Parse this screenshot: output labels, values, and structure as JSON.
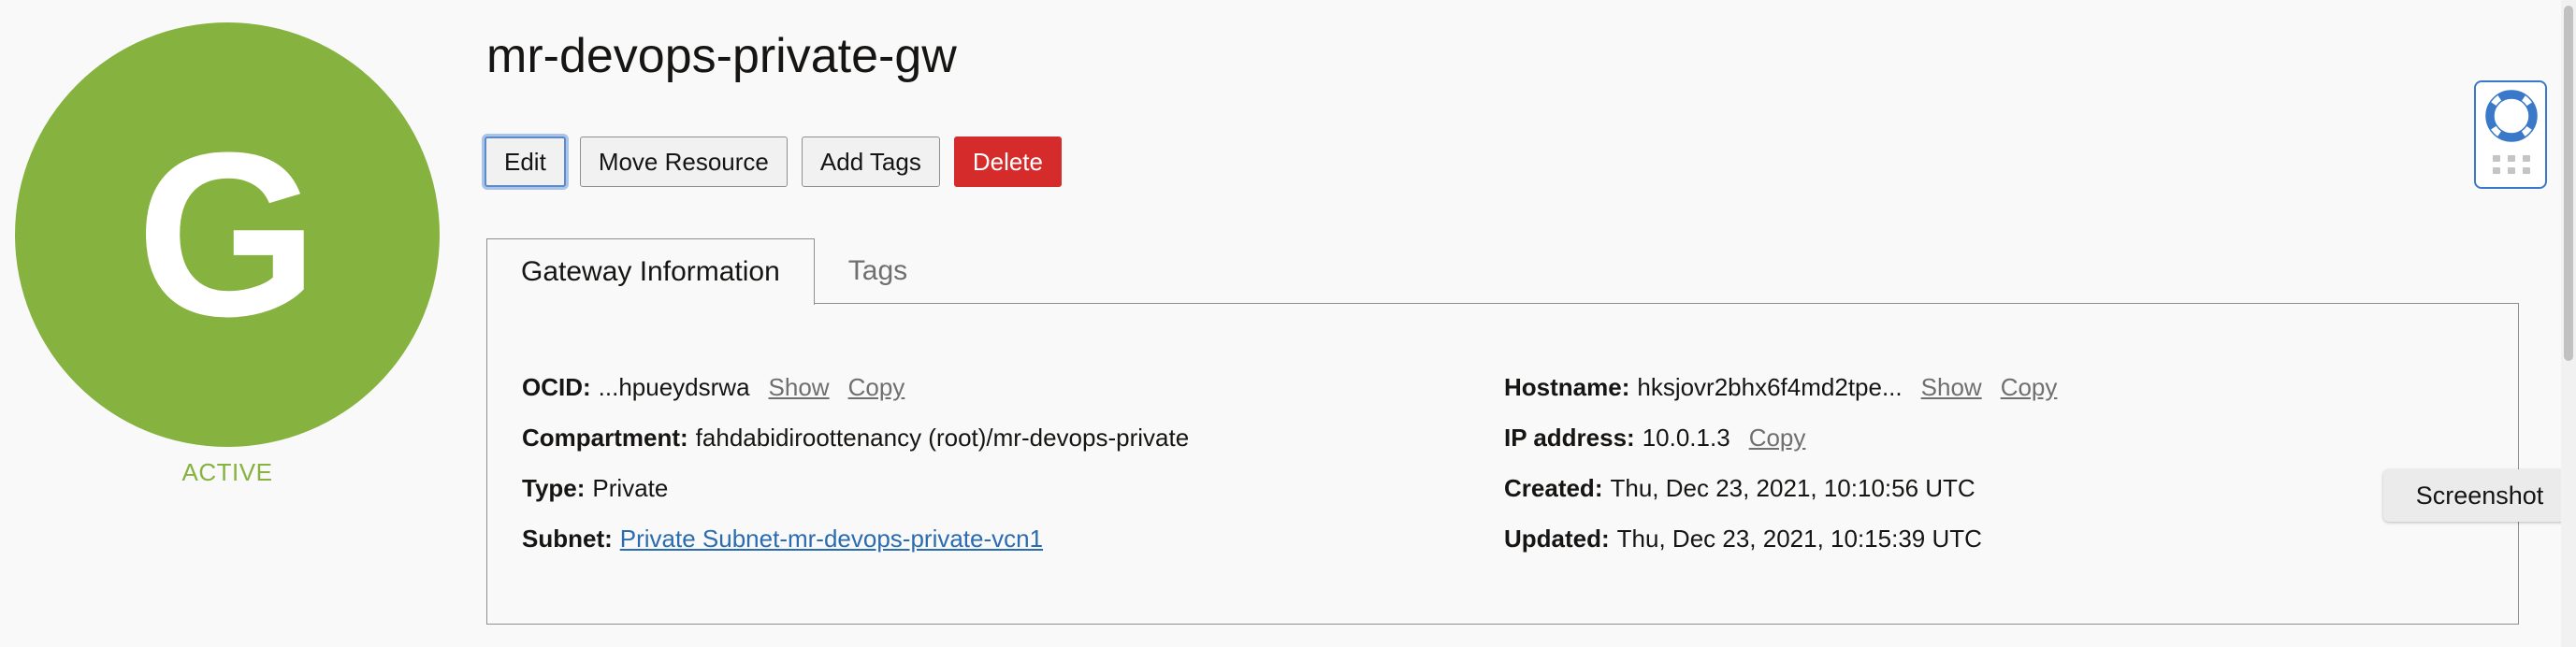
{
  "resource": {
    "avatar_letter": "G",
    "status": "ACTIVE",
    "status_color": "#86b23f",
    "name": "mr-devops-private-gw"
  },
  "toolbar": {
    "edit": "Edit",
    "move": "Move Resource",
    "add_tags": "Add Tags",
    "delete": "Delete",
    "delete_color": "#d52b2b"
  },
  "tabs": [
    {
      "label": "Gateway Information",
      "active": true
    },
    {
      "label": "Tags",
      "active": false
    }
  ],
  "info": {
    "ocid": {
      "label": "OCID:",
      "value": "...hpueydsrwa",
      "show": "Show",
      "copy": "Copy"
    },
    "compartment": {
      "label": "Compartment:",
      "value": "fahdabidiroottenancy (root)/mr-devops-private"
    },
    "type": {
      "label": "Type:",
      "value": "Private"
    },
    "subnet": {
      "label": "Subnet:",
      "value": "Private Subnet-mr-devops-private-vcn1"
    },
    "hostname": {
      "label": "Hostname:",
      "value": "hksjovr2bhx6f4md2tpe...",
      "show": "Show",
      "copy": "Copy"
    },
    "ip": {
      "label": "IP address:",
      "value": "10.0.1.3",
      "copy": "Copy"
    },
    "created": {
      "label": "Created:",
      "value": "Thu, Dec 23, 2021, 10:10:56 UTC"
    },
    "updated": {
      "label": "Updated:",
      "value": "Thu, Dec 23, 2021, 10:15:39 UTC"
    }
  },
  "help_widget": {
    "icon": "lifebuoy-icon"
  },
  "screenshot_button": "Screenshot"
}
